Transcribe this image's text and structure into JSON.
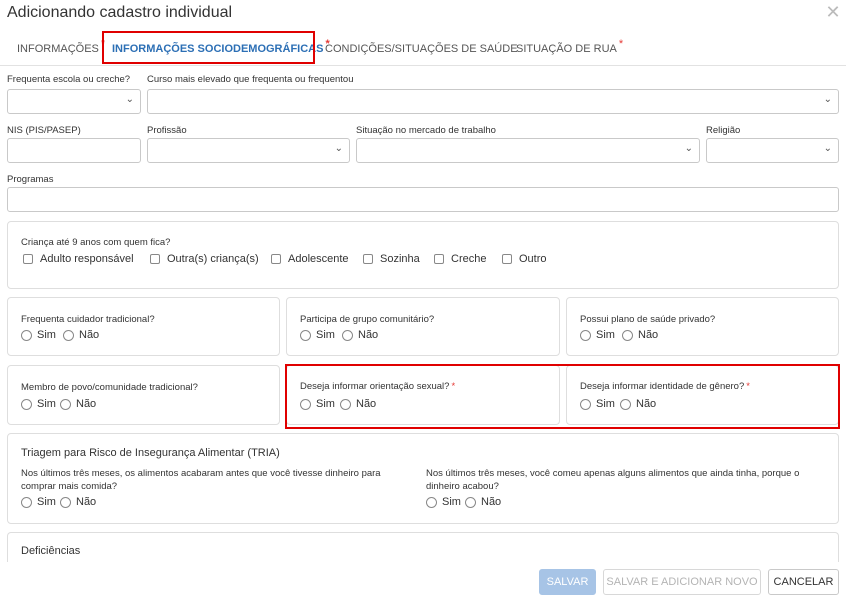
{
  "dialog": {
    "title": "Adicionando cadastro individual",
    "close_glyph": "✕"
  },
  "tabs": [
    {
      "label": "INFORMAÇÕES",
      "required": "*"
    },
    {
      "label": "INFORMAÇÕES SOCIODEMOGRÁFICAS",
      "required": "*"
    },
    {
      "label": "CONDIÇÕES/SITUAÇÕES DE SAÚDE",
      "required": ""
    },
    {
      "label": "SITUAÇÃO DE RUA",
      "required": "*"
    }
  ],
  "form": {
    "frequenta_escola": {
      "label": "Frequenta escola ou creche?",
      "value": ""
    },
    "curso": {
      "label": "Curso mais elevado que frequenta ou frequentou",
      "value": ""
    },
    "nis": {
      "label": "NIS (PIS/PASEP)",
      "value": ""
    },
    "profissao": {
      "label": "Profissão",
      "value": ""
    },
    "mercado": {
      "label": "Situação no mercado de trabalho",
      "value": ""
    },
    "religiao": {
      "label": "Religião",
      "value": ""
    },
    "programas": {
      "label": "Programas",
      "value": ""
    }
  },
  "crianca": {
    "question": "Criança até 9 anos com quem fica?",
    "options": [
      "Adulto responsável",
      "Outra(s) criança(s)",
      "Adolescente",
      "Sozinha",
      "Creche",
      "Outro"
    ]
  },
  "questions": {
    "cuidador": {
      "label": "Frequenta cuidador tradicional?",
      "required": ""
    },
    "grupo": {
      "label": "Participa de grupo comunitário?",
      "required": ""
    },
    "plano": {
      "label": "Possui plano de saúde privado?",
      "required": ""
    },
    "povo": {
      "label": "Membro de povo/comunidade tradicional?",
      "required": ""
    },
    "orientacao": {
      "label": "Deseja informar orientação sexual?",
      "required": "*"
    },
    "identidade": {
      "label": "Deseja informar identidade de gênero?",
      "required": "*"
    }
  },
  "radio": {
    "yes": "Sim",
    "no": "Não"
  },
  "tria": {
    "title": "Triagem para Risco de Insegurança Alimentar (TRIA)",
    "q1": "Nos últimos três meses, os alimentos acabaram antes que você tivesse dinheiro para comprar mais comida?",
    "q2": "Nos últimos três meses, você comeu apenas alguns alimentos que ainda tinha, porque o dinheiro acabou?"
  },
  "deficiencias": {
    "title": "Deficiências"
  },
  "footer": {
    "save": "SALVAR",
    "save_add": "SALVAR E ADICIONAR NOVO",
    "cancel": "CANCELAR"
  },
  "colors": {
    "accent": "#2c6fb5",
    "highlight": "#e00000",
    "required": "#e53935",
    "primary_button": "#a7c4e6"
  }
}
